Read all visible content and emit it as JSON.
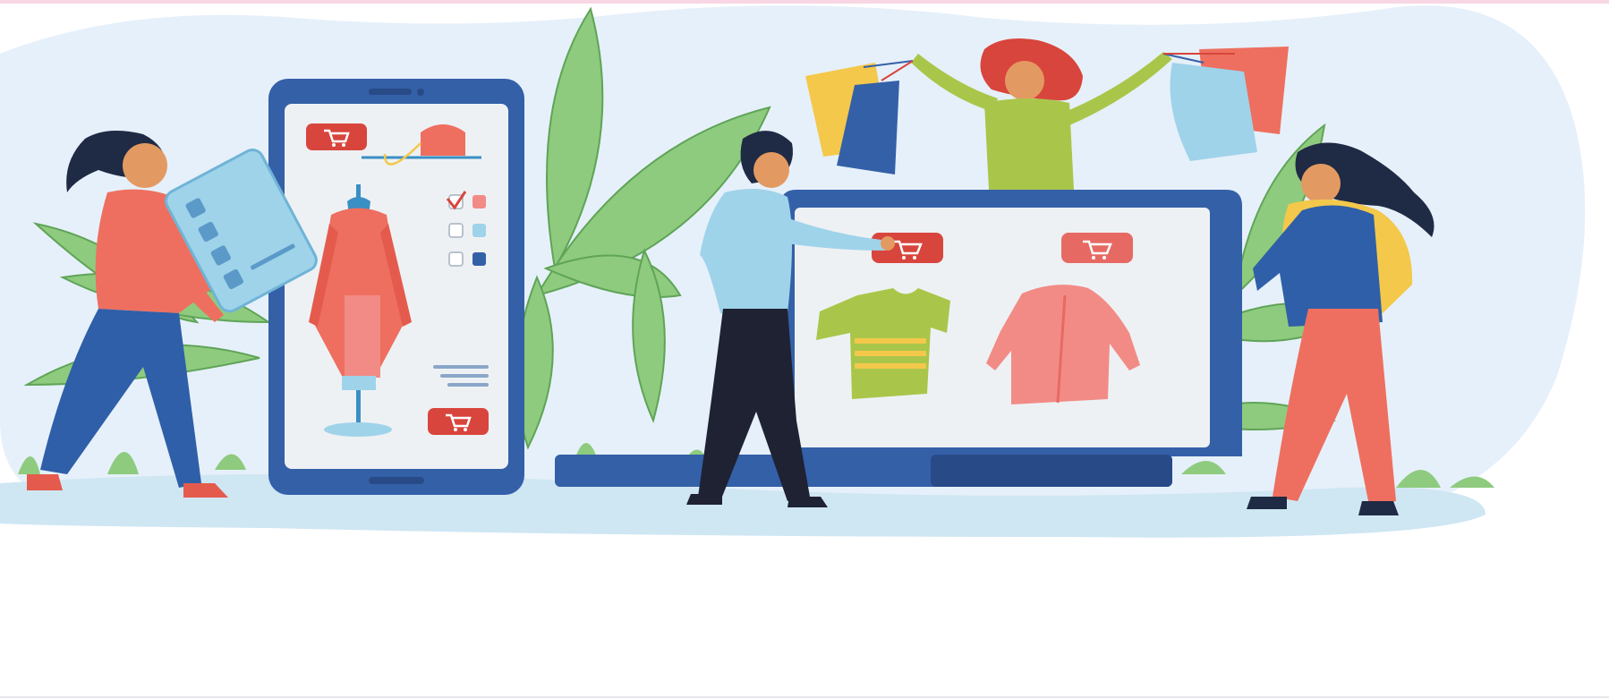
{
  "scene": {
    "description_icons": [
      "shopping-cart-icon",
      "checkbox-icon",
      "credit-card-icon",
      "t-shirt-icon",
      "jacket-icon",
      "shopping-bag-icon",
      "handbag-icon",
      "mannequin-icon"
    ]
  },
  "colors": {
    "top_strip": "#f8d6e4",
    "backdrop": "#e6f0fa",
    "ground": "#cfe6f3",
    "device_frame": "#3460a8",
    "device_frame_dark": "#284b88",
    "screen": "#eef1f4",
    "cart_badge": "#d8453c",
    "leaf": "#8ecb7e",
    "leaf_dark": "#5fa457",
    "coral": "#ee6f5f",
    "denim": "#2f5fa8",
    "skin": "#e39a62",
    "hair_dark": "#1f2a44",
    "hair_red": "#d8453c",
    "light_blue": "#9fd3ea",
    "olive": "#a9c64a",
    "pink": "#f28b86",
    "yellow": "#f3c84b",
    "navy": "#1f2233",
    "bottom_line": "#e7e9ee"
  }
}
